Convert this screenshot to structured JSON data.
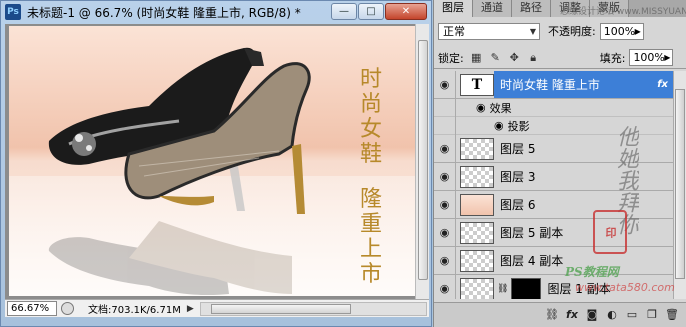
{
  "document": {
    "app_icon": "Ps",
    "title": "未标题-1 @ 66.7% (时尚女鞋    隆重上市, RGB/8) *",
    "window_buttons": {
      "minimize": "—",
      "maximize": "□",
      "close": "✕"
    },
    "canvas_text": {
      "line1": "时尚女鞋",
      "line2": "隆重上市"
    },
    "status": {
      "zoom": "66.67%",
      "doc_info": "文档:703.1K/6.71M",
      "arrow": "▶"
    },
    "colors": {
      "canvas_text": "#b7892a",
      "selection": "#3d7fd7"
    }
  },
  "layers_panel": {
    "tabs": [
      "图层",
      "通道",
      "路径",
      "调整",
      "蒙版"
    ],
    "active_tab": 0,
    "blend_mode": "正常",
    "opacity_label": "不透明度:",
    "opacity_value": "100%",
    "lock_label": "锁定:",
    "fill_label": "填充:",
    "fill_value": "100%",
    "layers": [
      {
        "name": "时尚女鞋    隆重上市",
        "thumb": "T",
        "fx": "fx",
        "selected": true
      },
      {
        "name": "效果",
        "sub": true
      },
      {
        "name": "投影",
        "sub": true
      },
      {
        "name": "图层 5"
      },
      {
        "name": "图层 3"
      },
      {
        "name": "图层 6"
      },
      {
        "name": "图层 5 副本"
      },
      {
        "name": "图层 4 副本"
      },
      {
        "name": "图层 1 副本"
      }
    ],
    "bottom_icons": [
      "link-icon",
      "fx-icon",
      "mask-icon",
      "adjustment-icon",
      "group-icon",
      "new-layer-icon",
      "trash-icon"
    ]
  },
  "watermarks": {
    "site_top": "思缘设计论坛 www.MISSYUAN.COM",
    "signature": "他她我拜你",
    "seal": "印",
    "ps_site": "PS教程网",
    "ps_url": "www.tata580.com"
  }
}
